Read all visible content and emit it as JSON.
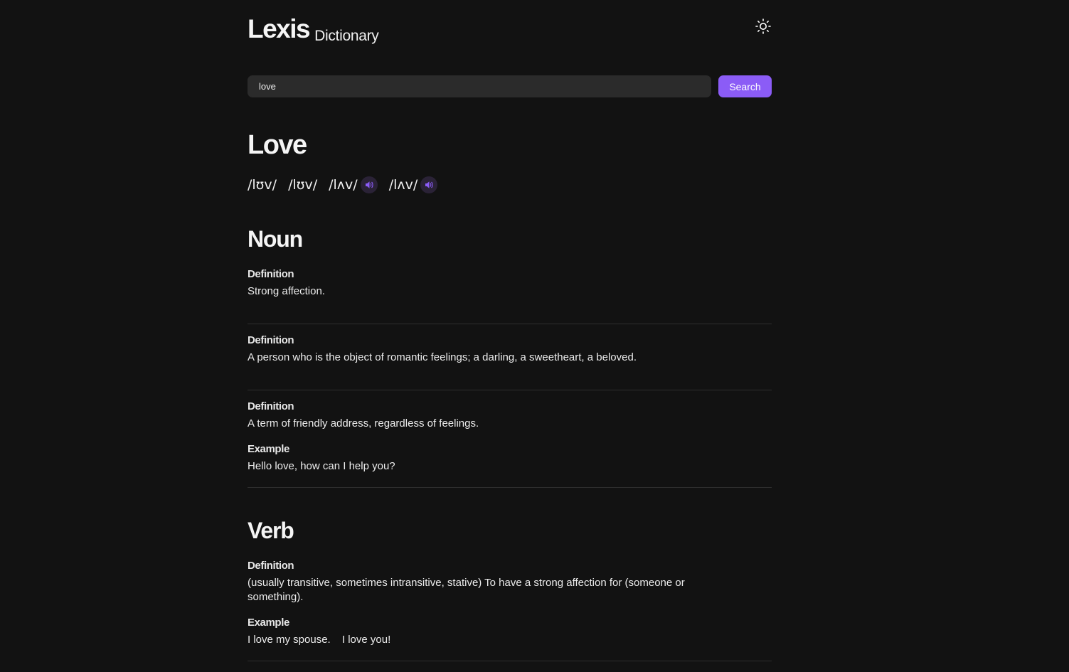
{
  "header": {
    "title": "Lexis",
    "subtitle": "Dictionary",
    "theme_icon": "sun-icon"
  },
  "search": {
    "value": "love",
    "placeholder": "",
    "button_label": "Search"
  },
  "result": {
    "word": "Love",
    "phonetics": [
      {
        "text": "/lʊv/",
        "has_audio": false
      },
      {
        "text": "/lʊv/",
        "has_audio": false
      },
      {
        "text": "/lʌv/",
        "has_audio": true
      },
      {
        "text": "/lʌv/",
        "has_audio": true
      }
    ],
    "meanings": [
      {
        "part_of_speech": "Noun",
        "definitions": [
          {
            "label": "Definition",
            "text": "Strong affection."
          },
          {
            "label": "Definition",
            "text": "A person who is the object of romantic feelings; a darling, a sweetheart, a beloved."
          },
          {
            "label": "Definition",
            "text": "A term of friendly address, regardless of feelings.",
            "example_label": "Example",
            "example": "Hello love, how can I help you?"
          }
        ]
      },
      {
        "part_of_speech": "Verb",
        "definitions": [
          {
            "label": "Definition",
            "text": "(usually transitive, sometimes intransitive, stative) To have a strong affection for (someone or something).",
            "example_label": "Example",
            "examples": [
              "I love my spouse.",
              "I love you!"
            ]
          }
        ]
      }
    ]
  },
  "colors": {
    "background": "#121212",
    "accent": "#8b5cf6",
    "input_bg": "#2b2b2b",
    "divider": "#2e2e2e"
  }
}
